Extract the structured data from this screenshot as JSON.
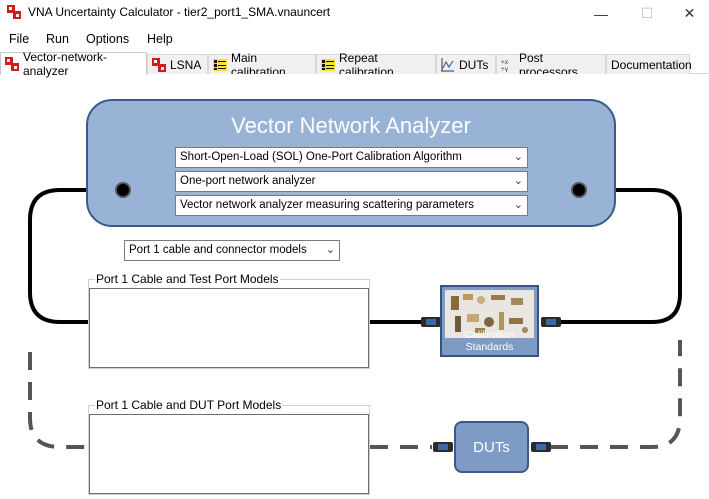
{
  "window": {
    "title": "VNA Uncertainty Calculator - tier2_port1_SMA.vnauncert",
    "controls": {
      "minimize": "—",
      "maximize": "☐",
      "close": "✕"
    }
  },
  "menu": [
    "File",
    "Run",
    "Options",
    "Help"
  ],
  "tabs": [
    {
      "label": "Vector-network-analyzer",
      "icon": "vna-icon",
      "active": true
    },
    {
      "label": "LSNA",
      "icon": "lsna-icon",
      "active": false
    },
    {
      "label": "Main calibration",
      "icon": "main-calibration-icon",
      "active": false
    },
    {
      "label": "Repeat calibration",
      "icon": "repeat-calibration-icon",
      "active": false
    },
    {
      "label": "DUTs",
      "icon": "duts-chart-icon",
      "active": false
    },
    {
      "label": "Post processors",
      "icon": "post-processors-icon",
      "active": false
    },
    {
      "label": "Documentation",
      "icon": "",
      "active": false
    }
  ],
  "vna": {
    "title": "Vector Network Analyzer",
    "algorithm": "Short-Open-Load (SOL) One-Port Calibration Algorithm",
    "analyzer_type": "One-port network analyzer",
    "measurement": "Vector network analyzer measuring scattering parameters"
  },
  "port1_models_select": "Port 1 cable and connector models",
  "test_port_group": {
    "title": "Port 1 Cable and Test Port Models"
  },
  "dut_port_group": {
    "title": "Port 1 Cable and DUT Port Models"
  },
  "calibration_standards": {
    "label": "Calibration Standards"
  },
  "duts": {
    "label": "DUTs"
  },
  "colors": {
    "vna_fill": "#99b3d6",
    "vna_border": "#3b5a8a",
    "block_fill": "#7d9bc4",
    "wire": "#000000",
    "dashed_wire": "#555555"
  }
}
